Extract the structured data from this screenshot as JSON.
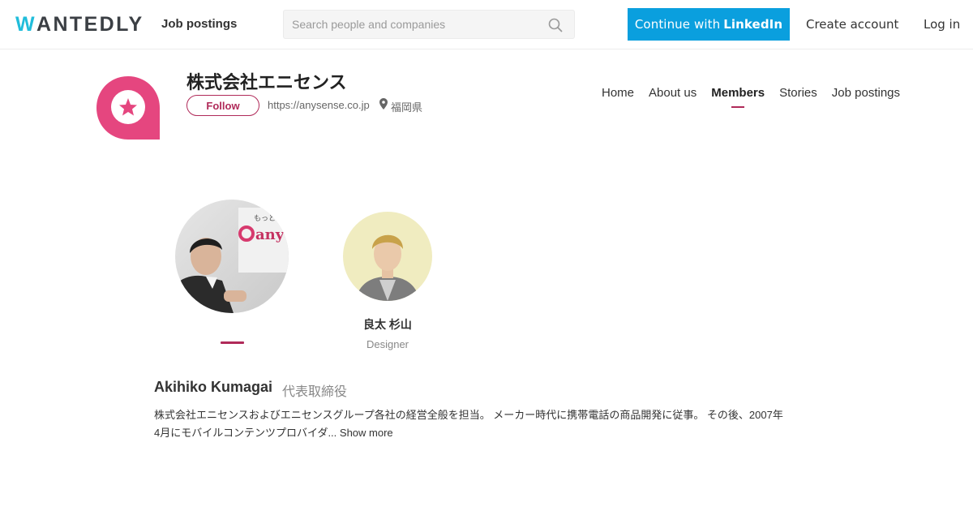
{
  "header": {
    "logo_text": "WANTEDLY",
    "logo_first_letter": "W",
    "logo_rest": "ANTEDLY",
    "nav_job_postings": "Job postings",
    "search_placeholder": "Search people and companies",
    "linkedin_prefix": "Continue with",
    "linkedin_brand": "LinkedIn",
    "create_account": "Create account",
    "login": "Log in"
  },
  "company": {
    "name": "株式会社エニセンス",
    "follow_label": "Follow",
    "url": "https://anysense.co.jp",
    "location": "福岡県",
    "brand_color": "#e5467f",
    "tabs": [
      {
        "label": "Home",
        "active": false
      },
      {
        "label": "About us",
        "active": false
      },
      {
        "label": "Members",
        "active": true
      },
      {
        "label": "Stories",
        "active": false
      },
      {
        "label": "Job postings",
        "active": false
      }
    ]
  },
  "members": {
    "list": [
      {
        "name": "Akihiko Kumagai",
        "role": "代表取締役",
        "selected": true
      },
      {
        "name": "良太 杉山",
        "role": "Designer",
        "selected": false
      }
    ],
    "selected_detail": {
      "name": "Akihiko Kumagai",
      "role": "代表取締役",
      "bio": "株式会社エニセンスおよびエニセンスグループ各社の経営全般を担当。 メーカー時代に携帯電話の商品開発に従事。 その後、2007年4月にモバイルコンテンツプロバイダ... ",
      "show_more": "Show more"
    }
  },
  "colors": {
    "accent": "#b02a59",
    "linkedin_blue": "#0a9fde",
    "logo_teal": "#21bddb"
  }
}
